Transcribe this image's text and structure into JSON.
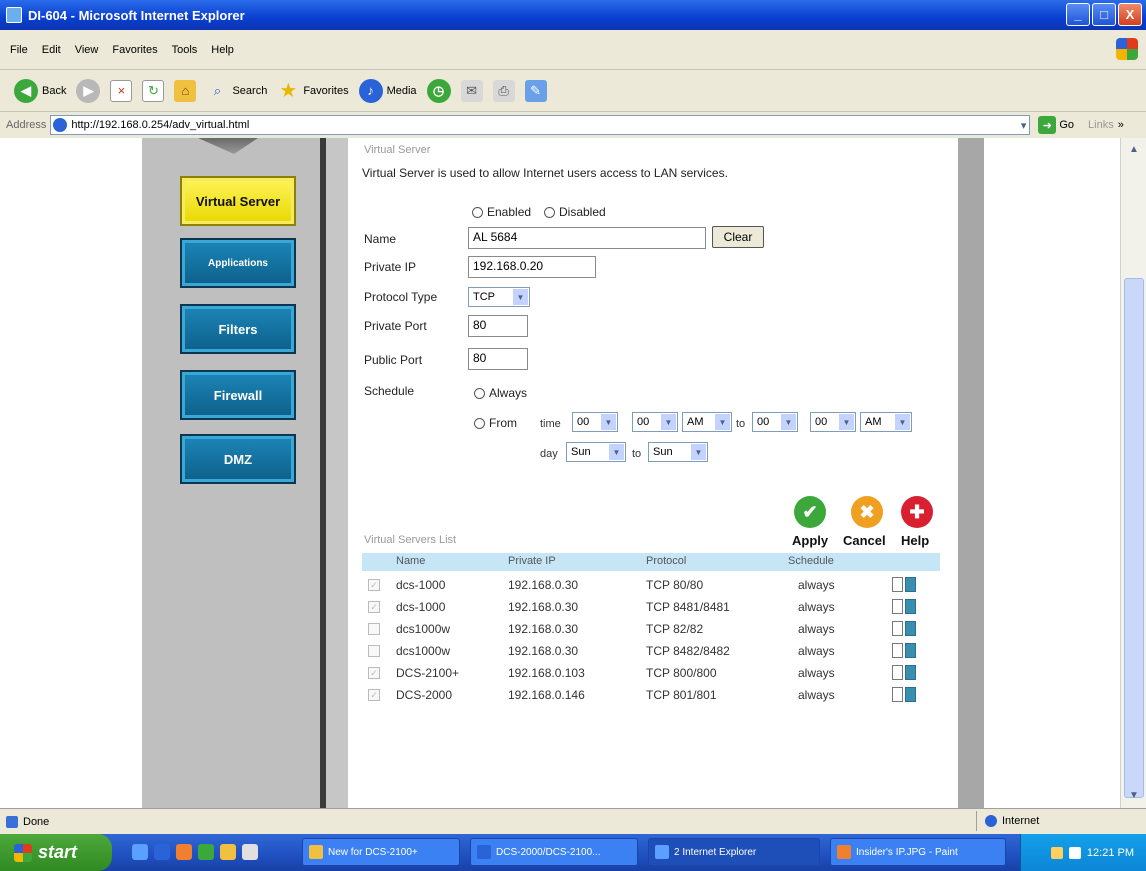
{
  "window": {
    "title": "DI-604 - Microsoft Internet Explorer",
    "controls": {
      "minimize": "_",
      "maximize": "□",
      "close": "X"
    }
  },
  "menu": [
    "File",
    "Edit",
    "View",
    "Favorites",
    "Tools",
    "Help"
  ],
  "toolbar": {
    "back": "Back",
    "search": "Search",
    "favorites": "Favorites",
    "media": "Media",
    "back_glyph": "◀",
    "forward_glyph": "▶",
    "stop_glyph": "×",
    "refresh_glyph": "↻",
    "home_glyph": "⌂",
    "search_glyph": "⌕",
    "star_glyph": "★",
    "media_glyph": "♪",
    "history_glyph": "◷",
    "mail_glyph": "✉",
    "print_glyph": "⎙",
    "edit_glyph": "✎"
  },
  "address": {
    "label": "Address",
    "url": "http://192.168.0.254/adv_virtual.html",
    "go": "Go",
    "go_glyph": "➜",
    "links": "Links",
    "dropdown_glyph": "▾",
    "more_glyph": "»"
  },
  "nav": {
    "items": [
      {
        "label": "Virtual Server",
        "active": true
      },
      {
        "label": "Applications",
        "active": false
      },
      {
        "label": "Filters",
        "active": false
      },
      {
        "label": "Firewall",
        "active": false
      },
      {
        "label": "DMZ",
        "active": false
      }
    ]
  },
  "form": {
    "section_title": "Virtual Server",
    "description": "Virtual Server is used to allow Internet users access to LAN services.",
    "enabled_label": "Enabled",
    "disabled_label": "Disabled",
    "name_label": "Name",
    "name_value": "AL 5684",
    "clear_label": "Clear",
    "private_ip_label": "Private IP",
    "private_ip_value": "192.168.0.20",
    "protocol_label": "Protocol Type",
    "protocol_value": "TCP",
    "private_port_label": "Private Port",
    "private_port_value": "80",
    "public_port_label": "Public Port",
    "public_port_value": "80",
    "schedule_label": "Schedule",
    "always_label": "Always",
    "from_label": "From",
    "time_label": "time",
    "to_label": "to",
    "day_label": "day",
    "from_hour": "00",
    "from_min": "00",
    "from_ampm": "AM",
    "to_hour": "00",
    "to_min": "00",
    "to_ampm": "AM",
    "from_day": "Sun",
    "to_day": "Sun",
    "select_arrow": "▼"
  },
  "actions": {
    "apply": "Apply",
    "cancel": "Cancel",
    "help": "Help",
    "apply_glyph": "✔",
    "cancel_glyph": "✖",
    "help_glyph": "✚"
  },
  "list": {
    "title": "Virtual Servers List",
    "headers": {
      "name": "Name",
      "private_ip": "Private IP",
      "protocol": "Protocol",
      "schedule": "Schedule"
    },
    "check_glyph": "✓",
    "rows": [
      {
        "name": "dcs-1000",
        "ip": "192.168.0.30",
        "protocol": "TCP 80/80",
        "schedule": "always",
        "checked": true
      },
      {
        "name": "dcs-1000",
        "ip": "192.168.0.30",
        "protocol": "TCP 8481/8481",
        "schedule": "always",
        "checked": true
      },
      {
        "name": "dcs1000w",
        "ip": "192.168.0.30",
        "protocol": "TCP 82/82",
        "schedule": "always",
        "checked": false
      },
      {
        "name": "dcs1000w",
        "ip": "192.168.0.30",
        "protocol": "TCP 8482/8482",
        "schedule": "always",
        "checked": false
      },
      {
        "name": "DCS-2100+",
        "ip": "192.168.0.103",
        "protocol": "TCP 800/800",
        "schedule": "always",
        "checked": true
      },
      {
        "name": "DCS-2000",
        "ip": "192.168.0.146",
        "protocol": "TCP 801/801",
        "schedule": "always",
        "checked": true
      }
    ]
  },
  "scrollbar": {
    "up_glyph": "▲",
    "down_glyph": "▼"
  },
  "status": {
    "text": "Done",
    "zone": "Internet"
  },
  "taskbar": {
    "start": "start",
    "items": [
      "New for DCS-2100+",
      "DCS-2000/DCS-2100...",
      "2 Internet Explorer",
      "Insider's IP.JPG - Paint"
    ],
    "clock": "12:21 PM"
  }
}
